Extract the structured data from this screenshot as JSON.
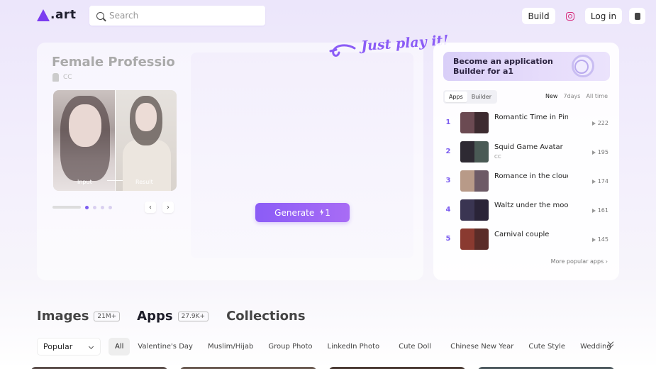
{
  "header": {
    "logo_text": ".art",
    "search_placeholder": "Search",
    "build_label": "Build",
    "login_label": "Log in"
  },
  "main": {
    "app_title": "Female Professional ...",
    "author": "CC",
    "preview_input_label": "Input",
    "preview_result_label": "Result",
    "generate_label": "Generate",
    "generate_cost": "1",
    "tagline": "Just play it!",
    "carousel_active_index": 0
  },
  "ranking": {
    "banner_title": "Become an application Builder for a1",
    "tabs": [
      "Apps",
      "Builder"
    ],
    "active_tab": "Apps",
    "time_tabs": [
      "New",
      "7days",
      "All time"
    ],
    "active_time": "New",
    "items": [
      {
        "rank": "1",
        "title": "Romantic Time in Pin...",
        "author": "",
        "count": "222",
        "colors": [
          "#6b4a52",
          "#3d2b30"
        ]
      },
      {
        "rank": "2",
        "title": "Squid Game Avatar",
        "author": "CC",
        "count": "195",
        "colors": [
          "#2e2a33",
          "#4a5a55"
        ]
      },
      {
        "rank": "3",
        "title": "Romance in the clouds",
        "author": "",
        "count": "174",
        "colors": [
          "#b89a88",
          "#6d5a66"
        ]
      },
      {
        "rank": "4",
        "title": "Waltz under the moon",
        "author": "",
        "count": "161",
        "colors": [
          "#3a3552",
          "#2a2438"
        ]
      },
      {
        "rank": "5",
        "title": "Carnival couple",
        "author": "",
        "count": "145",
        "colors": [
          "#8a3a30",
          "#5a2c28"
        ]
      }
    ],
    "more_label": "More popular apps"
  },
  "sections": {
    "images_label": "Images",
    "images_count": "21M+",
    "apps_label": "Apps",
    "apps_count": "27.9K+",
    "collections_label": "Collections"
  },
  "filters": {
    "sort_value": "Popular",
    "chips": [
      "All",
      "Valentine's Day",
      "Muslim/Hijab",
      "Group Photo",
      "LinkedIn Photo",
      "Cute Doll",
      "Chinese New Year",
      "Cute Style",
      "Wedding"
    ],
    "active_chip": "All"
  },
  "colors": {
    "accent": "#8b5cf6"
  }
}
